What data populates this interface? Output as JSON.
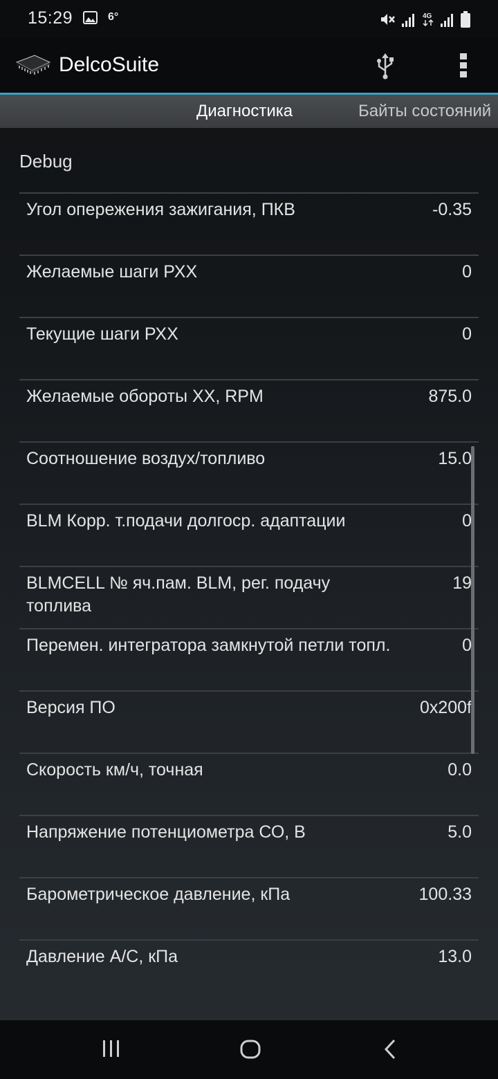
{
  "status_bar": {
    "time": "15:29",
    "temperature": "6°",
    "icons": [
      "image-icon",
      "mute-icon",
      "signal-icon",
      "4g-icon",
      "signal-icon-2",
      "battery-icon"
    ]
  },
  "app_bar": {
    "title": "DelcoSuite",
    "icons": [
      "chip-logo-icon",
      "usb-icon",
      "more-vert-icon"
    ]
  },
  "tabs": [
    {
      "label": "Диагностика",
      "active": true
    },
    {
      "label": "Байты состояний",
      "active": false
    }
  ],
  "section": {
    "title": "Debug"
  },
  "params": [
    {
      "label": "Угол опережения зажигания, ПКВ",
      "value": "-0.35"
    },
    {
      "label": "Желаемые шаги РХХ",
      "value": "0"
    },
    {
      "label": "Текущие шаги РХХ",
      "value": "0"
    },
    {
      "label": "Желаемые обороты ХХ, RPM",
      "value": "875.0"
    },
    {
      "label": "Соотношение воздух/топливо",
      "value": "15.0"
    },
    {
      "label": "BLM Корр. т.подачи долгоср. адаптации",
      "value": "0"
    },
    {
      "label": "BLMCELL № яч.пам. BLM, рег. подачу топлива",
      "value": "19"
    },
    {
      "label": "Перемен. интегратора замкнутой петли топл.",
      "value": "0"
    },
    {
      "label": "Версия ПО",
      "value": "0x200f"
    },
    {
      "label": "Скорость км/ч, точная",
      "value": "0.0"
    },
    {
      "label": "Напряжение потенциометра СО, В",
      "value": "5.0"
    },
    {
      "label": "Барометрическое давление, кПа",
      "value": "100.33"
    },
    {
      "label": "Давление A/C, кПа",
      "value": "13.0"
    }
  ],
  "nav_bar": {
    "icons": [
      "recents-icon",
      "home-icon",
      "back-icon"
    ]
  },
  "colors": {
    "accent": "#3aa0c9",
    "tab_bar": "#434649",
    "divider": "#3c4044"
  }
}
